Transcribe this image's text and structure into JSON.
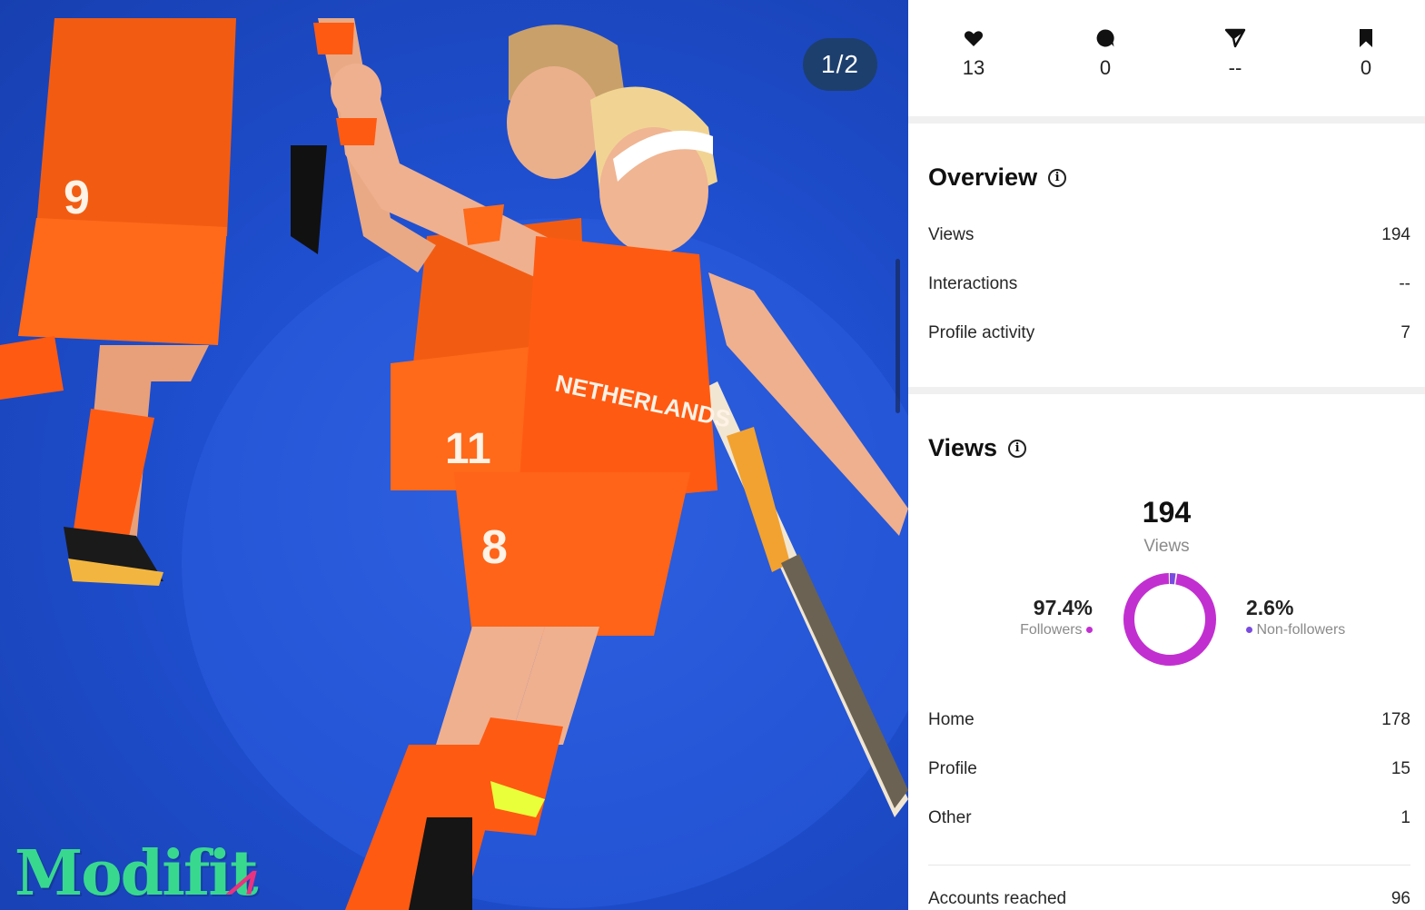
{
  "photo": {
    "counter": "1/2",
    "jersey_text": "NETHERLANDS",
    "jersey_numbers": [
      "9",
      "11",
      "8"
    ],
    "watermark": "Modifit"
  },
  "stats": [
    {
      "icon": "heart-icon",
      "value": "13"
    },
    {
      "icon": "comment-icon",
      "value": "0"
    },
    {
      "icon": "share-icon",
      "value": "--"
    },
    {
      "icon": "bookmark-icon",
      "value": "0"
    }
  ],
  "overview": {
    "title": "Overview",
    "rows": [
      {
        "label": "Views",
        "value": "194"
      },
      {
        "label": "Interactions",
        "value": "--"
      },
      {
        "label": "Profile activity",
        "value": "7"
      }
    ]
  },
  "views": {
    "title": "Views",
    "total": "194",
    "total_label": "Views",
    "followers_pct": "97.4%",
    "followers_label": "Followers",
    "nonfollowers_pct": "2.6%",
    "nonfollowers_label": "Non-followers",
    "rows": [
      {
        "label": "Home",
        "value": "178"
      },
      {
        "label": "Profile",
        "value": "15"
      },
      {
        "label": "Other",
        "value": "1"
      }
    ],
    "accounts_reached_label": "Accounts reached",
    "accounts_reached_value": "96"
  },
  "chart_data": {
    "type": "pie",
    "categories": [
      "Followers",
      "Non-followers"
    ],
    "values": [
      97.4,
      2.6
    ],
    "colors": [
      "#c22fd1",
      "#7a4be0"
    ]
  }
}
